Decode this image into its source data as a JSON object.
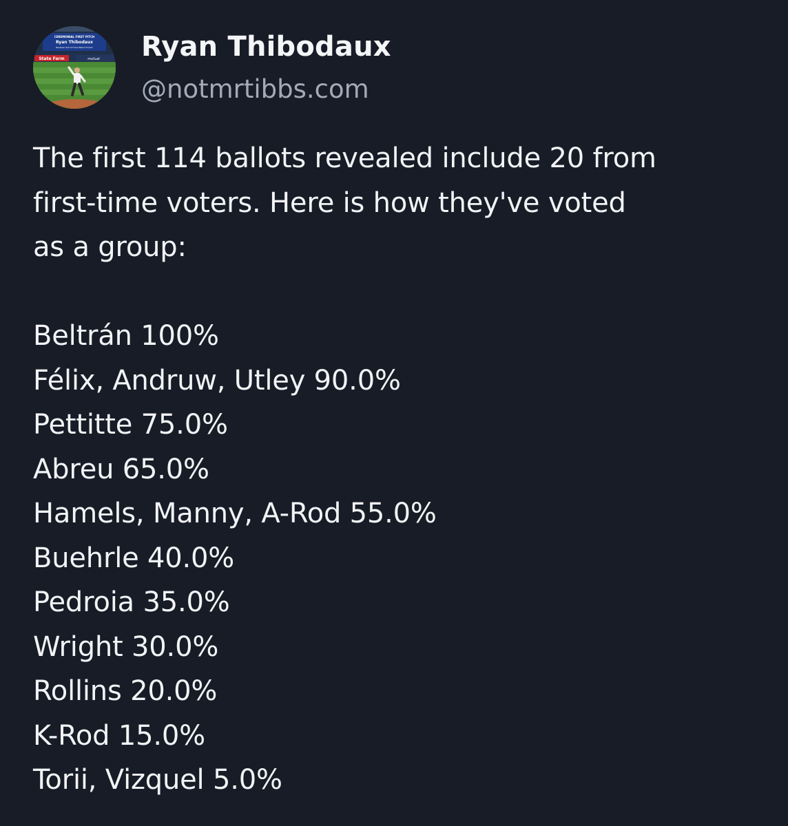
{
  "author": {
    "display_name": "Ryan Thibodaux",
    "handle": "@notmrtibbs.com",
    "avatar": {
      "icon": "profile-photo-ceremonial-first-pitch",
      "banner_line1": "CEREMONIAL FIRST PITCH",
      "banner_line2": "Ryan Thibodaux",
      "banner_line3": "Baseball Hall of Fame Ballot Tracker",
      "sign_left": "State Farm",
      "sign_right": "mutual"
    }
  },
  "post": {
    "intro_lines": [
      "The first 114 ballots revealed include 20 from",
      "first-time voters. Here is how they've voted",
      "as a group:"
    ],
    "results": [
      "Beltrán 100%",
      "Félix, Andruw, Utley 90.0%",
      "Pettitte 75.0%",
      "Abreu 65.0%",
      "Hamels, Manny, A-Rod 55.0%",
      "Buehrle 40.0%",
      "Pedroia 35.0%",
      "Wright 30.0%",
      "Rollins 20.0%",
      "K-Rod 15.0%",
      "Torii, Vizquel 5.0%"
    ]
  },
  "colors": {
    "background": "#181c27",
    "text": "#f1f3f5",
    "handle": "#a2abb8"
  }
}
